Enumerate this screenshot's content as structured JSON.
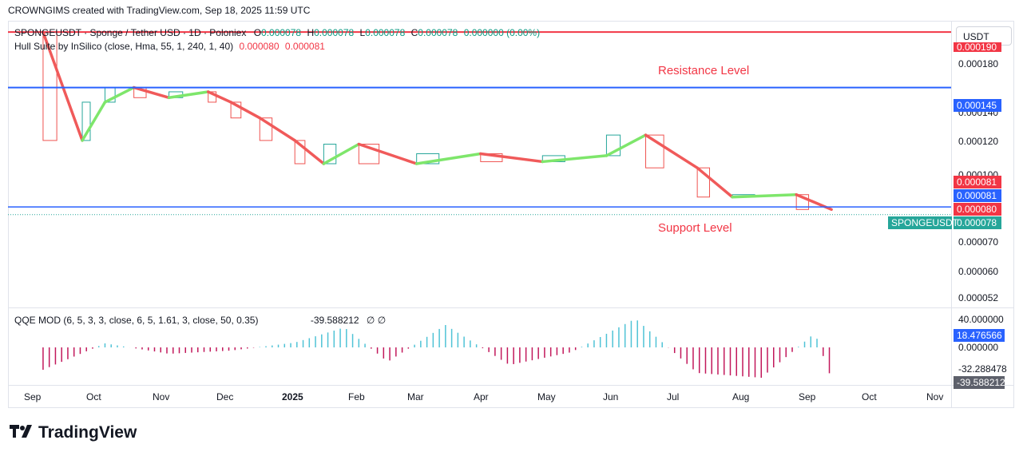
{
  "header": {
    "credit": "CROWNGIMS created with TradingView.com, Sep 18, 2025 11:59 UTC"
  },
  "legend": {
    "symbol": "SPONGEUSDT · Sponge / Tether USD · 1D · Poloniex",
    "o_label": "O",
    "o": "0.000078",
    "h_label": "H",
    "h": "0.000078",
    "l_label": "L",
    "l": "0.000078",
    "c_label": "C",
    "c": "0.000078",
    "change": "0.000000 (0.00%)",
    "hull_name": "Hull Suite by InSilico (close, Hma, 55, 1, 240, 1, 40)",
    "hull_v1": "0.000080",
    "hull_v2": "0.000081"
  },
  "qqe_legend": {
    "name": "QQE MOD (6, 5, 3, 3, close, 6, 5, 1.61, 3, close, 50, 0.35)",
    "value": "-39.588212",
    "flags": "∅ ∅"
  },
  "currency": "USDT",
  "annotations": {
    "resistance": "Resistance Level",
    "support": "Support Level"
  },
  "price_axis": {
    "ticks": [
      "0.000180",
      "0.000140",
      "0.000120",
      "0.000100",
      "0.000070",
      "0.000060",
      "0.000052"
    ],
    "tags": [
      {
        "label": "0.000190",
        "color": "#f23645"
      },
      {
        "label": "0.000145",
        "color": "#2962ff"
      },
      {
        "label": "0.000081",
        "color": "#f23645"
      },
      {
        "label": "0.000081",
        "color": "#2962ff"
      },
      {
        "label": "0.000080",
        "color": "#f23645"
      },
      {
        "label": "0.000078",
        "color": "#26a69a"
      }
    ],
    "symbol_tag": "SPONGEUSDT"
  },
  "qqe_axis": {
    "ticks": [
      "40.000000",
      "0.000000",
      "-32.288478"
    ],
    "tags": [
      {
        "label": "18.476566",
        "color": "#2962ff"
      },
      {
        "label": "-39.588212",
        "color": "#5d606b"
      }
    ]
  },
  "time_axis": [
    "Sep",
    "Oct",
    "Nov",
    "Dec",
    "2025",
    "Feb",
    "Mar",
    "Apr",
    "May",
    "Jun",
    "Jul",
    "Aug",
    "Sep",
    "Oct",
    "Nov"
  ],
  "brand": "TradingView",
  "colors": {
    "up": "#26a69a",
    "hull_up": "#7ee66b",
    "hull_down": "#f05a5a",
    "resistance": "#f23645",
    "level": "#2962ff",
    "qqe_pos": "#4fc3d6",
    "qqe_neg": "#c2185b"
  },
  "chart_data": {
    "type": "line",
    "title": "",
    "series": [
      {
        "name": "Hull Suite by InSilico",
        "x": [
          "2024-09-01",
          "2024-09-20",
          "2024-10-01",
          "2024-10-15",
          "2024-11-01",
          "2024-11-20",
          "2024-12-01",
          "2024-12-15",
          "2025-01-01",
          "2025-01-15",
          "2025-02-01",
          "2025-03-01",
          "2025-04-01",
          "2025-05-01",
          "2025-06-01",
          "2025-06-20",
          "2025-07-15",
          "2025-08-01",
          "2025-09-01",
          "2025-09-18"
        ],
        "y": [
          0.00019,
          0.000112,
          0.000135,
          0.000145,
          0.000138,
          0.000142,
          0.000135,
          0.000125,
          0.000112,
          0.0001,
          0.00011,
          0.0001,
          0.000105,
          0.000101,
          0.000104,
          0.000115,
          9.8e-05,
          8.5e-05,
          8.6e-05,
          8e-05
        ]
      }
    ],
    "levels": {
      "resistance": 0.00019,
      "level_145": 0.000145,
      "support": 8.1e-05,
      "last_close": 7.8e-05
    },
    "qqe": {
      "x": [
        "2024-09-01",
        "2024-10-01",
        "2024-11-01",
        "2024-12-01",
        "2025-01-01",
        "2025-01-25",
        "2025-02-15",
        "2025-03-15",
        "2025-04-15",
        "2025-05-15",
        "2025-06-15",
        "2025-07-15",
        "2025-08-15",
        "2025-09-10",
        "2025-09-18"
      ],
      "y": [
        -28,
        5,
        -8,
        -4,
        6,
        25,
        -18,
        28,
        -22,
        -6,
        36,
        -32,
        -38,
        18,
        -39.588212
      ],
      "ylim": [
        -45,
        45
      ]
    },
    "ylim": [
      5e-05,
      0.0002
    ],
    "grid": true,
    "legend": "top-left"
  }
}
